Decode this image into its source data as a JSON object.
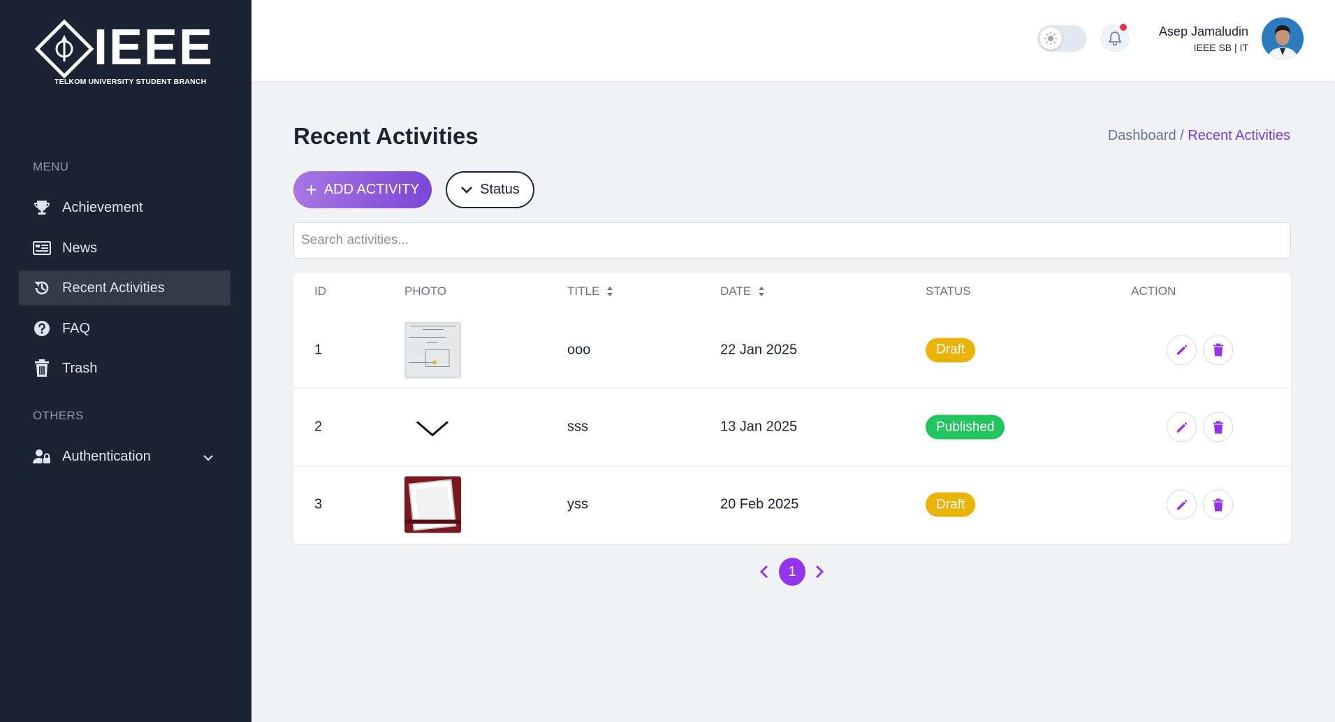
{
  "brand": {
    "logo_text": "IEEE",
    "logo_subtitle": "TELKOM UNIVERSITY STUDENT BRANCH"
  },
  "sidebar": {
    "menu_label": "MENU",
    "items": [
      {
        "label": "Achievement",
        "icon": "trophy-icon"
      },
      {
        "label": "News",
        "icon": "newspaper-icon"
      },
      {
        "label": "Recent Activities",
        "icon": "history-icon",
        "active": true
      },
      {
        "label": "FAQ",
        "icon": "question-circle-icon"
      },
      {
        "label": "Trash",
        "icon": "trash-icon"
      }
    ],
    "others_label": "OTHERS",
    "others_items": [
      {
        "label": "Authentication",
        "icon": "user-lock-icon",
        "expandable": true
      }
    ]
  },
  "header": {
    "user_name": "Asep Jamaludin",
    "user_role": "IEEE SB | IT",
    "notification_dot": true
  },
  "page": {
    "title": "Recent Activities",
    "breadcrumb": {
      "parent": "Dashboard /",
      "current": "Recent Activities"
    },
    "add_button": "ADD ACTIVITY",
    "status_filter": "Status",
    "search_placeholder": "Search activities..."
  },
  "table": {
    "columns": [
      "ID",
      "PHOTO",
      "TITLE",
      "DATE",
      "STATUS",
      "ACTION"
    ],
    "rows": [
      {
        "id": "1",
        "title": "ooo",
        "date": "22 Jan 2025",
        "status": "Draft"
      },
      {
        "id": "2",
        "title": "sss",
        "date": "13 Jan 2025",
        "status": "Published"
      },
      {
        "id": "3",
        "title": "yss",
        "date": "20 Feb 2025",
        "status": "Draft"
      }
    ]
  },
  "pagination": {
    "current_page": "1"
  },
  "colors": {
    "sidebar_bg": "#1c2434",
    "accent": "#9333ea",
    "draft": "#eab308",
    "published": "#22c55e"
  }
}
